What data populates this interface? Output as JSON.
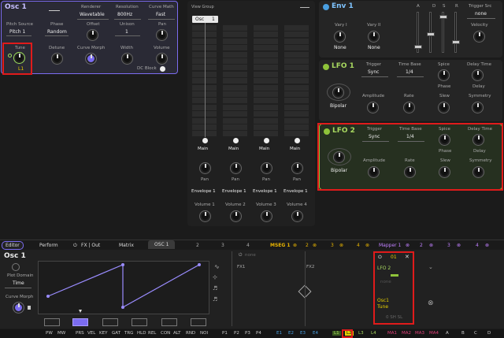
{
  "osc": {
    "title": "Osc 1",
    "renderer_lbl": "Renderer",
    "renderer": "Wavetable",
    "resolution_lbl": "Resolution",
    "resolution": "800Hz",
    "curvemath_lbl": "Curve Math",
    "curvemath": "Fast",
    "pitchsrc_lbl": "Pitch Source",
    "pitchsrc": "Pitch 1",
    "phase_lbl": "Phase",
    "phase": "Random",
    "offset_lbl": "Offset",
    "unison_lbl": "Unison",
    "unison": "1",
    "pan_lbl": "Pan",
    "tune_lbl": "Tune",
    "tune_src": "L1",
    "detune_lbl": "Detune",
    "curvemorph_lbl": "Curve Morph",
    "width_lbl": "Width",
    "volume_lbl": "Volume",
    "dcblock": "DC Block"
  },
  "viewgroup": {
    "title": "View Group",
    "osc": "Osc",
    "osc_n": "1",
    "mains": [
      "Main",
      "Main",
      "Main",
      "Main"
    ],
    "pans": [
      "Pan",
      "Pan",
      "Pan",
      "Pan"
    ],
    "envs": [
      "Envelope 1",
      "Envelope 1",
      "Envelope 1",
      "Envelope 1"
    ],
    "vols": [
      "Volume 1",
      "Volume 2",
      "Volume 3",
      "Volume 4"
    ]
  },
  "env": {
    "title": "Env 1",
    "adsr": [
      "A",
      "D",
      "S",
      "R"
    ],
    "trigsrc_lbl": "Trigger Src",
    "trigsrc": "none",
    "vary1": "Vary I",
    "vary2": "Vary II",
    "none1": "None",
    "none2": "None",
    "velocity": "Velocity"
  },
  "lfo1": {
    "title": "LFO 1",
    "trigger_lbl": "Trigger",
    "trigger": "Sync",
    "timebase_lbl": "Time Base",
    "timebase": "1/4",
    "spice": "Spice",
    "delaytime": "Delay Time",
    "phase": "Phase",
    "delay": "Delay",
    "bipolar": "Bipolar",
    "amplitude": "Amplitude",
    "rate": "Rate",
    "slew": "Slew",
    "symmetry": "Symmetry"
  },
  "lfo2": {
    "title": "LFO 2",
    "trigger_lbl": "Trigger",
    "trigger": "Sync",
    "timebase_lbl": "Time Base",
    "timebase": "1/4",
    "spice": "Spice",
    "delaytime": "Delay Time",
    "phase": "Phase",
    "delay": "Delay",
    "bipolar": "Bipolar",
    "amplitude": "Amplitude",
    "rate": "Rate",
    "slew": "Slew",
    "symmetry": "Symmetry"
  },
  "tabs": {
    "editor": "Editor",
    "perform": "Perform",
    "fxout": "FX | Out",
    "matrix": "Matrix",
    "osc1": "OSC 1",
    "n2": "2",
    "n3": "3",
    "n4": "4",
    "mseg": "MSEG 1",
    "m2": "2",
    "m3": "3",
    "m4": "4",
    "mapper": "Mapper 1",
    "p2": "2",
    "p3": "3",
    "p4": "4"
  },
  "editor": {
    "title": "Osc 1",
    "plotdomain_lbl": "Plot Domain",
    "plotdomain": "Time",
    "curvemorph_lbl": "Curve Morph",
    "none1": "none",
    "fx1": "FX1",
    "fx2": "FX2",
    "none2": "none",
    "mod_num": "01",
    "mod_src": "LFO 2",
    "mod_none": "none",
    "mod_target": "Osc1",
    "mod_param": "Tune",
    "mod_flags": "0 SH SL"
  },
  "bottom": [
    "PW",
    "MW",
    "PRS",
    "VEL",
    "KEY",
    "GAT",
    "TRG",
    "HLD",
    "REL",
    "CON",
    "ALT",
    "RND",
    "NOI",
    "P1",
    "P2",
    "P3",
    "P4",
    "E1",
    "E2",
    "E3",
    "E4",
    "L1",
    "L2",
    "L3",
    "L4",
    "MA1",
    "MA2",
    "MA3",
    "MA4",
    "A",
    "B",
    "C",
    "D"
  ],
  "colors": {
    "accent": "#7b6cf0",
    "lfo_green": "#8fc33a",
    "yellow": "#e8b400",
    "mapper": "#b070e0",
    "red": "#e01b1b"
  }
}
